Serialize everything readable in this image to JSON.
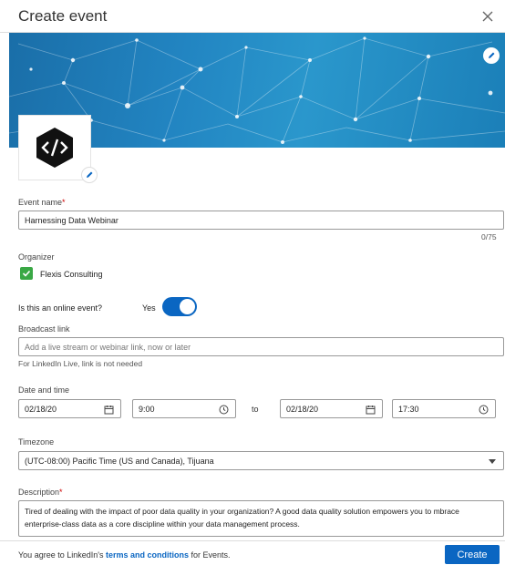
{
  "header": {
    "title": "Create event"
  },
  "icons": {
    "close": "close-icon",
    "edit": "pencil-icon",
    "calendar": "calendar-icon",
    "clock": "clock-icon",
    "check": "check-icon",
    "caret": "chevron-down-icon"
  },
  "colors": {
    "brand": "#0a66c2",
    "banner": "#1f82bf",
    "organizer_badge": "#3aa845"
  },
  "event_name": {
    "label": "Event name",
    "required_mark": "*",
    "value": "Harnessing Data Webinar",
    "counter": "0/75"
  },
  "organizer": {
    "label": "Organizer",
    "name": "Flexis Consulting"
  },
  "online": {
    "label": "Is this an online event?",
    "toggle_label": "Yes",
    "enabled": true
  },
  "broadcast": {
    "label": "Broadcast link",
    "placeholder": "Add a live stream or webinar link, now or later",
    "helper": "For LinkedIn Live, link is not needed"
  },
  "datetime": {
    "label": "Date and time",
    "start_date": "02/18/20",
    "start_time": "9:00",
    "separator": "to",
    "end_date": "02/18/20",
    "end_time": "17:30"
  },
  "timezone": {
    "label": "Timezone",
    "value": "(UTC-08:00) Pacific Time (US and Canada), Tijuana"
  },
  "description": {
    "label": "Description",
    "required_mark": "*",
    "value": "Tired of dealing with the impact of poor data quality in your organization? A good data quality solution empowers you to mbrace enterprise-class data as a core discipline within your data management process."
  },
  "footer": {
    "agree_prefix": "You agree to LinkedIn's ",
    "terms_link": "terms and conditions",
    "agree_suffix": " for Events.",
    "create_label": "Create"
  }
}
